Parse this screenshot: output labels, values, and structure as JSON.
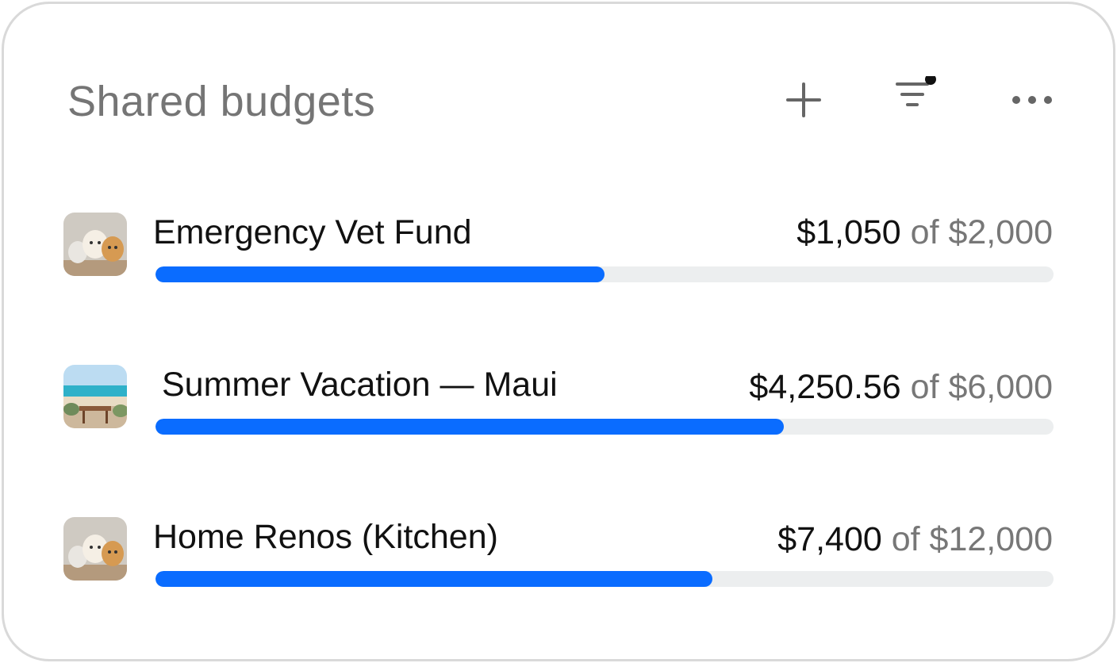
{
  "header": {
    "title": "Shared budgets",
    "add_icon": "plus-icon",
    "filter_icon": "filter-lines-icon",
    "more_icon": "more-horizontal-icon"
  },
  "colors": {
    "accent": "#0a6cff",
    "track": "#eceeef",
    "text_primary": "#111111",
    "text_secondary": "#777777",
    "border": "#d9d9d9"
  },
  "budgets": [
    {
      "name": "Emergency Vet Fund",
      "current": "$1,050",
      "of": "of $2,000",
      "progress": 0.5,
      "thumbnail": "pets-photo"
    },
    {
      "name": "Summer Vacation — Maui",
      "current": "$4,250.56",
      "of": "of $6,000",
      "progress": 0.7,
      "thumbnail": "beach-photo"
    },
    {
      "name": "Home Renos (Kitchen)",
      "current": "$7,400",
      "of": "of $12,000",
      "progress": 0.62,
      "thumbnail": "pets-photo"
    }
  ]
}
